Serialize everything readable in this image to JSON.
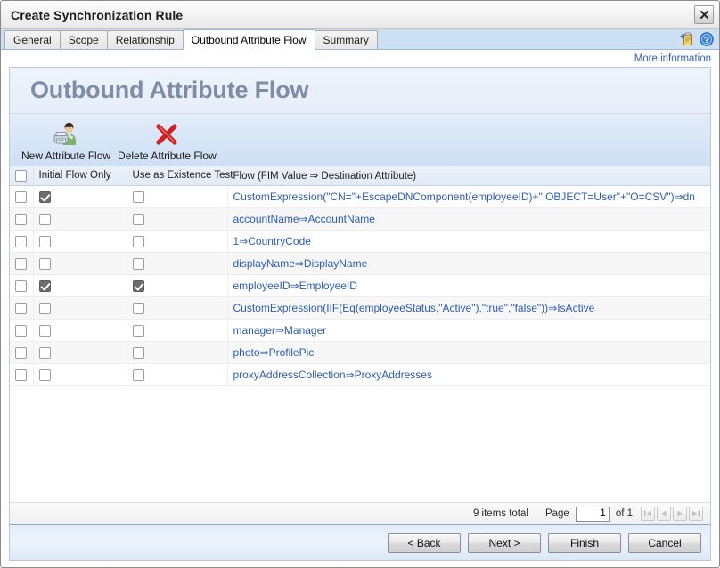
{
  "window": {
    "title": "Create Synchronization Rule",
    "close_label": "Close"
  },
  "tabs": [
    {
      "label": "General",
      "active": false
    },
    {
      "label": "Scope",
      "active": false
    },
    {
      "label": "Relationship",
      "active": false
    },
    {
      "label": "Outbound Attribute Flow",
      "active": true
    },
    {
      "label": "Summary",
      "active": false
    }
  ],
  "tab_icons": [
    {
      "name": "clipboard-add-icon"
    },
    {
      "name": "help-icon"
    }
  ],
  "more_information": "More information",
  "page": {
    "heading": "Outbound Attribute Flow"
  },
  "toolbar": {
    "buttons": [
      {
        "label": "New Attribute Flow",
        "icon": "new-attribute-flow-icon"
      },
      {
        "label": "Delete Attribute Flow",
        "icon": "delete-attribute-flow-icon"
      }
    ]
  },
  "grid": {
    "columns": [
      "",
      "Initial Flow Only",
      "Use as Existence Test",
      "Flow (FIM Value ⇒ Destination Attribute)"
    ],
    "rows": [
      {
        "selected": false,
        "initial_flow_only": true,
        "use_as_existence_test": false,
        "flow": "CustomExpression(\"CN=\"+EscapeDNComponent(employeeID)+\",OBJECT=User\"+\"O=CSV\")⇒dn"
      },
      {
        "selected": false,
        "initial_flow_only": false,
        "use_as_existence_test": false,
        "flow": "accountName⇒AccountName"
      },
      {
        "selected": false,
        "initial_flow_only": false,
        "use_as_existence_test": false,
        "flow": "1⇒CountryCode"
      },
      {
        "selected": false,
        "initial_flow_only": false,
        "use_as_existence_test": false,
        "flow": "displayName⇒DisplayName"
      },
      {
        "selected": false,
        "initial_flow_only": true,
        "use_as_existence_test": true,
        "flow": "employeeID⇒EmployeeID"
      },
      {
        "selected": false,
        "initial_flow_only": false,
        "use_as_existence_test": false,
        "flow": "CustomExpression(IIF(Eq(employeeStatus,\"Active\"),\"true\",\"false\"))⇒IsActive"
      },
      {
        "selected": false,
        "initial_flow_only": false,
        "use_as_existence_test": false,
        "flow": "manager⇒Manager"
      },
      {
        "selected": false,
        "initial_flow_only": false,
        "use_as_existence_test": false,
        "flow": "photo⇒ProfilePic"
      },
      {
        "selected": false,
        "initial_flow_only": false,
        "use_as_existence_test": false,
        "flow": "proxyAddressCollection⇒ProxyAddresses"
      }
    ]
  },
  "pager": {
    "items_total": "9 items total",
    "page_label": "Page",
    "page_value": "1",
    "of_label": "of 1",
    "first_title": "First page",
    "prev_title": "Previous page",
    "next_title": "Next page",
    "last_title": "Last page"
  },
  "wizard_buttons": [
    {
      "label": "< Back",
      "name": "back-button"
    },
    {
      "label": "Next >",
      "name": "next-button"
    },
    {
      "label": "Finish",
      "name": "finish-button"
    },
    {
      "label": "Cancel",
      "name": "cancel-button"
    }
  ],
  "colors": {
    "link": "#2b5cb8",
    "heading": "#7d8da5",
    "tab_active_bg": "#ffffff",
    "tabstrip_bg": "#ccdff3",
    "banner_bg": "#e9effa",
    "toolbar_bg": "#d7e5f6",
    "delete_icon": "#cc2222",
    "row_stripe": "#f7f7f7"
  }
}
